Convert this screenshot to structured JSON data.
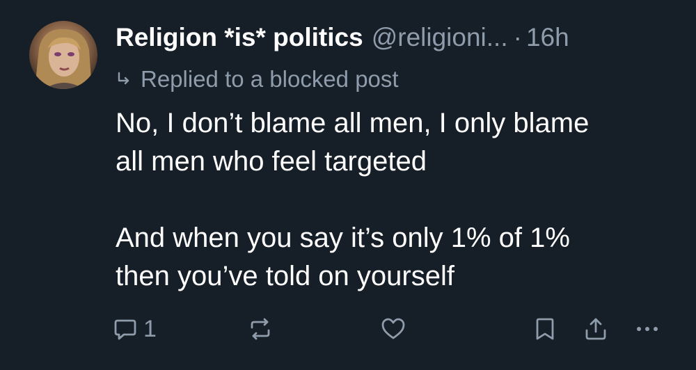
{
  "post": {
    "author_name": "Religion *is* politics",
    "author_handle": "@religioni...",
    "separator": "·",
    "timestamp": "16h",
    "reply_context": "Replied to a blocked post",
    "text_lines": [
      "No, I don’t blame all men, I only blame",
      "all men who feel targeted",
      "And when you say it’s only 1% of 1%",
      "then you’ve told on yourself"
    ],
    "reply_count": "1"
  },
  "colors": {
    "background": "#161e27",
    "text_primary": "#ffffff",
    "text_secondary": "#8f9cab"
  },
  "icons": {
    "reply": "speech-bubble-icon",
    "repost": "repost-arrows-icon",
    "like": "heart-icon",
    "bookmark": "bookmark-icon",
    "share": "share-upload-icon",
    "more": "ellipsis-icon",
    "reply_context": "reply-arrow-icon"
  }
}
